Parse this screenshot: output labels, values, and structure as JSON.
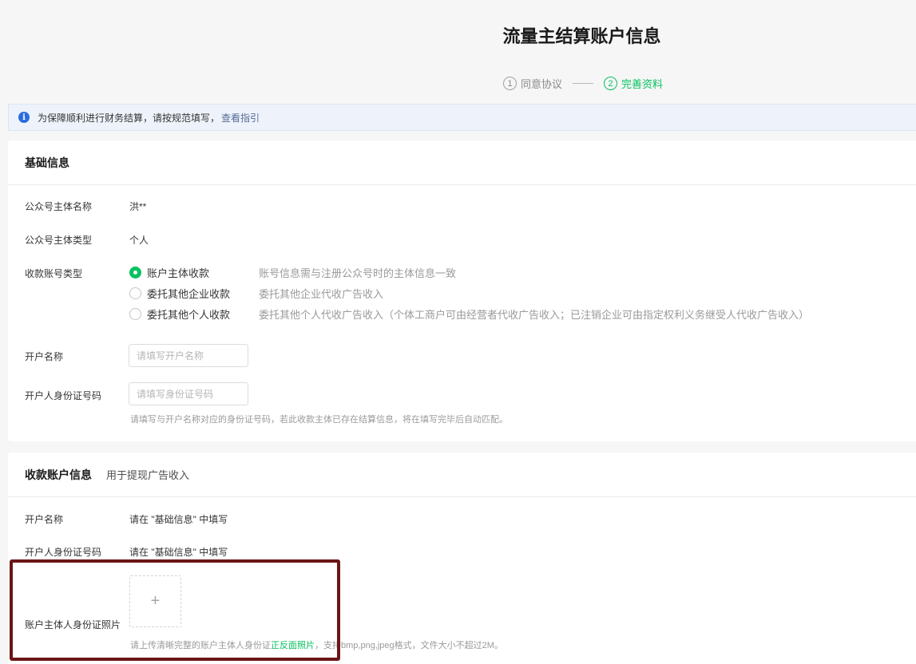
{
  "header": {
    "title": "流量主结算账户信息",
    "steps": [
      {
        "num": "1",
        "label": "同意协议"
      },
      {
        "num": "2",
        "label": "完善资料"
      }
    ]
  },
  "notice": {
    "icon": "info-icon",
    "text": "为保障顺利进行财务结算，请按规范填写，",
    "link": "查看指引"
  },
  "basic": {
    "title": "基础信息",
    "entity_name_label": "公众号主体名称",
    "entity_name_value": "洪**",
    "entity_type_label": "公众号主体类型",
    "entity_type_value": "个人",
    "account_type_label": "收款账号类型",
    "account_types": [
      {
        "label": "账户主体收款",
        "desc": "账号信息需与注册公众号时的主体信息一致",
        "checked": true
      },
      {
        "label": "委托其他企业收款",
        "desc": "委托其他企业代收广告收入",
        "checked": false
      },
      {
        "label": "委托其他个人收款",
        "desc": "委托其他个人代收广告收入（个体工商户可由经营者代收广告收入；已注销企业可由指定权利义务继受人代收广告收入）",
        "checked": false
      }
    ],
    "holder_name_label": "开户名称",
    "holder_name_placeholder": "请填写开户名称",
    "holder_id_label": "开户人身份证号码",
    "holder_id_placeholder": "请填写身份证号码",
    "holder_id_hint": "请填写与开户名称对应的身份证号码，若此收款主体已存在结算信息，将在填写完毕后自动匹配。"
  },
  "account": {
    "title": "收款账户信息",
    "subtitle": "用于提现广告收入",
    "holder_name_label": "开户名称",
    "holder_name_value": "请在 \"基础信息\" 中填写",
    "holder_id_label": "开户人身份证号码",
    "holder_id_value": "请在 \"基础信息\" 中填写",
    "id_photo_label": "账户主体人身份证照片",
    "upload_symbol": "+",
    "upload_hint_pre": "请上传清晰完整的账户主体人身份证",
    "upload_hint_highlight": "正反面照片",
    "upload_hint_post": "，支持bmp,png,jpeg格式，文件大小不超过2M。"
  },
  "colors": {
    "accent": "#07c160",
    "link": "#576b95",
    "highlight_border": "#6b1515"
  }
}
